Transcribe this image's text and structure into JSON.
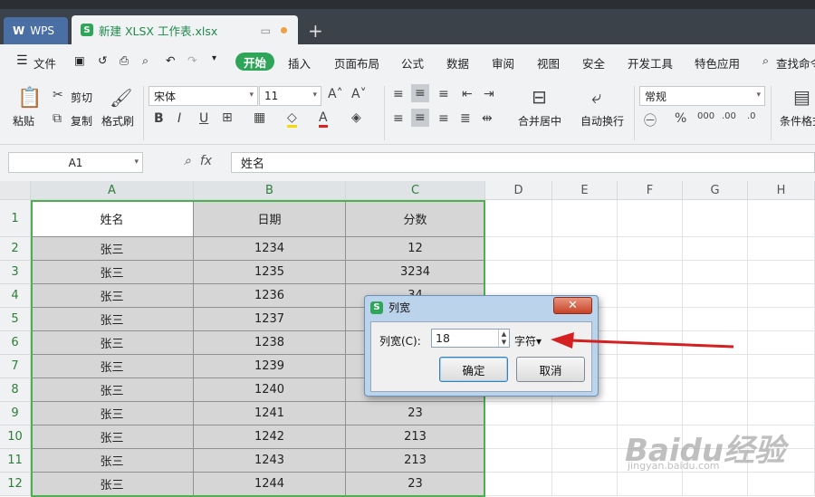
{
  "titlebar": {
    "wps_tab": "WPS",
    "file_tab": "新建 XLSX 工作表.xlsx",
    "add_tab": "+"
  },
  "menubar": {
    "file_menu": "文件",
    "start": "开始",
    "items": [
      "插入",
      "页面布局",
      "公式",
      "数据",
      "审阅",
      "视图",
      "安全",
      "开发工具",
      "特色应用"
    ],
    "search": "查找命令"
  },
  "ribbon": {
    "paste": "粘贴",
    "cut": "剪切",
    "copy": "复制",
    "format_painter": "格式刷",
    "font_name": "宋体",
    "font_size": "11",
    "merge_center": "合并居中",
    "wrap_text": "自动换行",
    "number_format": "常规",
    "percent": "%",
    "cond_format": "条件格式"
  },
  "formula_bar": {
    "name_box": "A1",
    "fx": "fx",
    "formula": "姓名"
  },
  "sheet": {
    "columns": [
      "A",
      "B",
      "C",
      "D",
      "E",
      "F",
      "G",
      "H"
    ],
    "rows": [
      "1",
      "2",
      "3",
      "4",
      "5",
      "6",
      "7",
      "8",
      "9",
      "10",
      "11",
      "12"
    ],
    "header": [
      "姓名",
      "日期",
      "分数"
    ],
    "data": [
      [
        "张三",
        "1234",
        "12"
      ],
      [
        "张三",
        "1235",
        "3234"
      ],
      [
        "张三",
        "1236",
        "34"
      ],
      [
        "张三",
        "1237",
        ""
      ],
      [
        "张三",
        "1238",
        ""
      ],
      [
        "张三",
        "1239",
        ""
      ],
      [
        "张三",
        "1240",
        ""
      ],
      [
        "张三",
        "1241",
        "23"
      ],
      [
        "张三",
        "1242",
        "213"
      ],
      [
        "张三",
        "1243",
        "213"
      ],
      [
        "张三",
        "1244",
        "23"
      ]
    ]
  },
  "dialog": {
    "title": "列宽",
    "label": "列宽(C):",
    "value": "18",
    "unit": "字符▾",
    "ok": "确定",
    "cancel": "取消",
    "close": "✕"
  },
  "watermark": {
    "brand": "Baidu经验",
    "url": "jingyan.baidu.com"
  }
}
